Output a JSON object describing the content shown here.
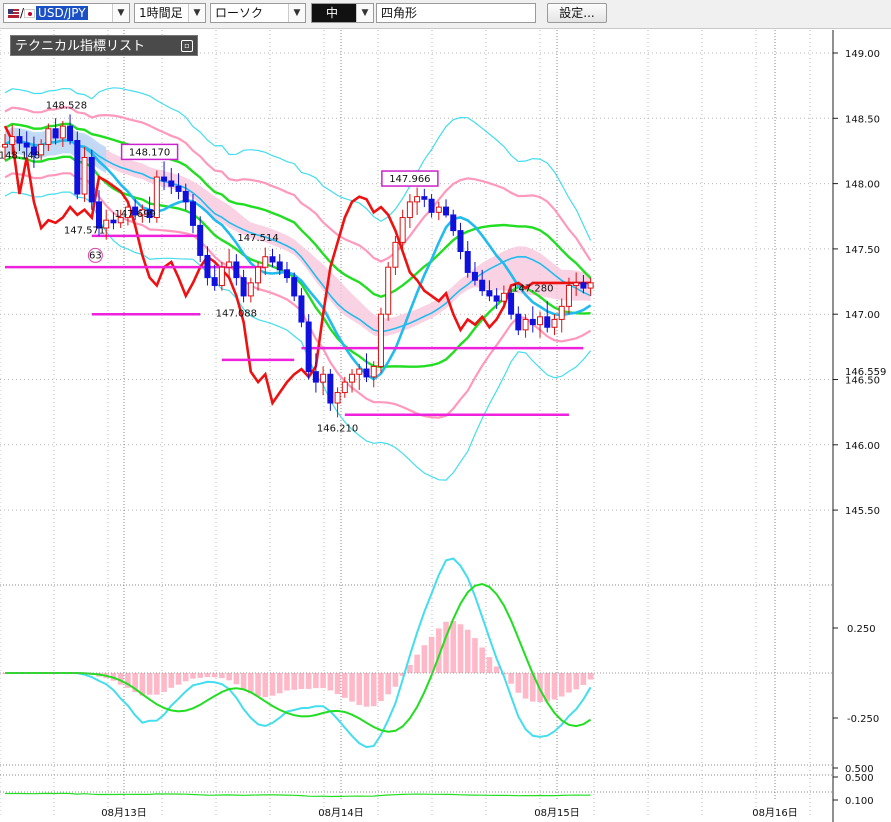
{
  "toolbar": {
    "pair": "USD/JPY",
    "timeframe": "1時間足",
    "chart_type": "ローソク",
    "tool_size": "中",
    "shape": "四角形",
    "settings": "設定..."
  },
  "indicator_panel": {
    "title": "テクニカル指標リスト"
  },
  "colors": {
    "bull_candle": "#dd1111",
    "bear_candle": "#1111dd",
    "bb_outer": "#44ddee",
    "bb_middle": "#ff99bb",
    "env_green": "#22dd22",
    "ma_blue": "#22bbee",
    "red_line": "#ee1111",
    "horiz_lines": "#ee22dd",
    "cloud": "#f8c8dc",
    "cloud_blue": "#bcd8f4"
  },
  "chart_data": [
    {
      "type": "line",
      "name_jp": "main",
      "y_ticks": [
        "149.00",
        "148.50",
        "148.00",
        "147.50",
        "147.00",
        "146.50",
        "146.00",
        "145.50"
      ],
      "current_price": "146.559",
      "x_ticks": [
        "08月13日",
        "08月14日",
        "08月15日",
        "08月16日"
      ],
      "ylim": [
        145.3,
        149.2
      ],
      "annotations": [
        {
          "text": "148.528",
          "x": 8.5,
          "y": 148.528
        },
        {
          "text": "148.148",
          "x": 2.0,
          "y": 148.148
        },
        {
          "text": "148.170",
          "x": 20.0,
          "y": 148.17,
          "boxed": true
        },
        {
          "text": "147.571",
          "x": 11.0,
          "y": 147.571
        },
        {
          "text": "147.699",
          "x": 18.0,
          "y": 147.699
        },
        {
          "text": "147.514",
          "x": 35.0,
          "y": 147.514
        },
        {
          "text": "147.088",
          "x": 32.0,
          "y": 147.088
        },
        {
          "text": "146.210",
          "x": 46.0,
          "y": 146.21
        },
        {
          "text": "147.966",
          "x": 56.0,
          "y": 147.966,
          "boxed": true
        },
        {
          "text": "147.280",
          "x": 73.0,
          "y": 147.28
        },
        {
          "text": "63",
          "x": 12.5,
          "y": 147.45,
          "circle": true
        }
      ],
      "candles": [
        [
          148.28,
          148.38,
          148.18,
          148.3
        ],
        [
          148.3,
          148.45,
          148.22,
          148.36
        ],
        [
          148.36,
          148.42,
          148.25,
          148.31
        ],
        [
          148.31,
          148.4,
          148.2,
          148.28
        ],
        [
          148.28,
          148.36,
          148.12,
          148.22
        ],
        [
          148.22,
          148.34,
          148.18,
          148.3
        ],
        [
          148.3,
          148.46,
          148.25,
          148.42
        ],
        [
          148.42,
          148.5,
          148.3,
          148.35
        ],
        [
          148.35,
          148.48,
          148.28,
          148.44
        ],
        [
          148.44,
          148.53,
          148.3,
          148.33
        ],
        [
          148.33,
          148.4,
          147.88,
          147.92
        ],
        [
          147.92,
          148.28,
          147.86,
          148.2
        ],
        [
          148.2,
          148.26,
          147.8,
          147.86
        ],
        [
          147.86,
          147.95,
          147.6,
          147.66
        ],
        [
          147.66,
          147.8,
          147.57,
          147.72
        ],
        [
          147.72,
          147.78,
          147.65,
          147.7
        ],
        [
          147.7,
          147.8,
          147.66,
          147.74
        ],
        [
          147.74,
          147.86,
          147.68,
          147.82
        ],
        [
          147.82,
          147.88,
          147.72,
          147.76
        ],
        [
          147.76,
          147.84,
          147.7,
          147.8
        ],
        [
          147.8,
          147.9,
          147.7,
          147.74
        ],
        [
          147.74,
          148.1,
          147.7,
          148.05
        ],
        [
          148.05,
          148.17,
          147.95,
          148.02
        ],
        [
          148.02,
          148.12,
          147.92,
          147.98
        ],
        [
          147.98,
          148.08,
          147.88,
          147.94
        ],
        [
          147.94,
          148.0,
          147.8,
          147.86
        ],
        [
          147.86,
          147.92,
          147.62,
          147.68
        ],
        [
          147.68,
          147.75,
          147.4,
          147.45
        ],
        [
          147.45,
          147.52,
          147.22,
          147.28
        ],
        [
          147.28,
          147.38,
          147.18,
          147.22
        ],
        [
          147.22,
          147.4,
          147.18,
          147.36
        ],
        [
          147.36,
          147.5,
          147.28,
          147.4
        ],
        [
          147.4,
          147.46,
          147.22,
          147.28
        ],
        [
          147.28,
          147.34,
          147.09,
          147.14
        ],
        [
          147.14,
          147.28,
          147.09,
          147.24
        ],
        [
          147.24,
          147.4,
          147.18,
          147.36
        ],
        [
          147.36,
          147.51,
          147.3,
          147.44
        ],
        [
          147.44,
          147.5,
          147.36,
          147.4
        ],
        [
          147.4,
          147.46,
          147.3,
          147.34
        ],
        [
          147.34,
          147.4,
          147.24,
          147.28
        ],
        [
          147.28,
          147.32,
          147.1,
          147.14
        ],
        [
          147.14,
          147.2,
          146.9,
          146.94
        ],
        [
          146.94,
          147.0,
          146.5,
          146.56
        ],
        [
          146.56,
          146.7,
          146.4,
          146.48
        ],
        [
          146.48,
          146.6,
          146.38,
          146.54
        ],
        [
          146.54,
          146.58,
          146.26,
          146.32
        ],
        [
          146.32,
          146.44,
          146.21,
          146.4
        ],
        [
          146.4,
          146.52,
          146.36,
          146.48
        ],
        [
          146.48,
          146.58,
          146.4,
          146.54
        ],
        [
          146.54,
          146.62,
          146.42,
          146.58
        ],
        [
          146.58,
          146.7,
          146.48,
          146.52
        ],
        [
          146.52,
          146.64,
          146.44,
          146.6
        ],
        [
          146.6,
          147.05,
          146.55,
          147.0
        ],
        [
          147.0,
          147.4,
          146.95,
          147.36
        ],
        [
          147.36,
          147.6,
          147.3,
          147.55
        ],
        [
          147.55,
          147.8,
          147.48,
          147.74
        ],
        [
          147.74,
          147.92,
          147.66,
          147.86
        ],
        [
          147.86,
          147.97,
          147.76,
          147.9
        ],
        [
          147.9,
          147.96,
          147.82,
          147.88
        ],
        [
          147.88,
          147.92,
          147.74,
          147.78
        ],
        [
          147.78,
          147.86,
          147.72,
          147.82
        ],
        [
          147.82,
          147.88,
          147.74,
          147.76
        ],
        [
          147.76,
          147.8,
          147.6,
          147.64
        ],
        [
          147.64,
          147.7,
          147.42,
          147.48
        ],
        [
          147.48,
          147.56,
          147.28,
          147.32
        ],
        [
          147.32,
          147.4,
          147.22,
          147.26
        ],
        [
          147.26,
          147.34,
          147.14,
          147.18
        ],
        [
          147.18,
          147.26,
          147.1,
          147.14
        ],
        [
          147.14,
          147.2,
          147.04,
          147.1
        ],
        [
          147.1,
          147.22,
          147.04,
          147.16
        ],
        [
          147.16,
          147.2,
          146.96,
          147.0
        ],
        [
          147.0,
          147.06,
          146.84,
          146.88
        ],
        [
          146.88,
          147.0,
          146.82,
          146.96
        ],
        [
          146.96,
          147.06,
          146.86,
          146.92
        ],
        [
          146.92,
          147.02,
          146.82,
          146.98
        ],
        [
          146.98,
          147.1,
          146.86,
          146.9
        ],
        [
          146.9,
          147.0,
          146.84,
          146.96
        ],
        [
          146.96,
          147.12,
          146.86,
          147.06
        ],
        [
          147.06,
          147.28,
          147.0,
          147.22
        ],
        [
          147.22,
          147.32,
          147.14,
          147.24
        ],
        [
          147.24,
          147.3,
          147.16,
          147.2
        ],
        [
          147.2,
          147.28,
          147.14,
          147.24
        ]
      ],
      "horizontal_lines": [
        {
          "y": 147.36,
          "x0": 0,
          "x1": 36
        },
        {
          "y": 147.0,
          "x0": 12,
          "x1": 27
        },
        {
          "y": 147.6,
          "x0": 12,
          "x1": 27
        },
        {
          "y": 146.65,
          "x0": 30,
          "x1": 40
        },
        {
          "y": 146.74,
          "x0": 41,
          "x1": 80
        },
        {
          "y": 146.23,
          "x0": 47,
          "x1": 78
        }
      ]
    },
    {
      "type": "line",
      "name_jp": "macd",
      "y_ticks": [
        "0.250",
        "-0.250"
      ],
      "ylim": [
        -0.45,
        0.45
      ]
    },
    {
      "type": "line",
      "name_jp": "bottom",
      "y_ticks": [
        "0.500",
        "0.500",
        "0.100"
      ]
    }
  ]
}
